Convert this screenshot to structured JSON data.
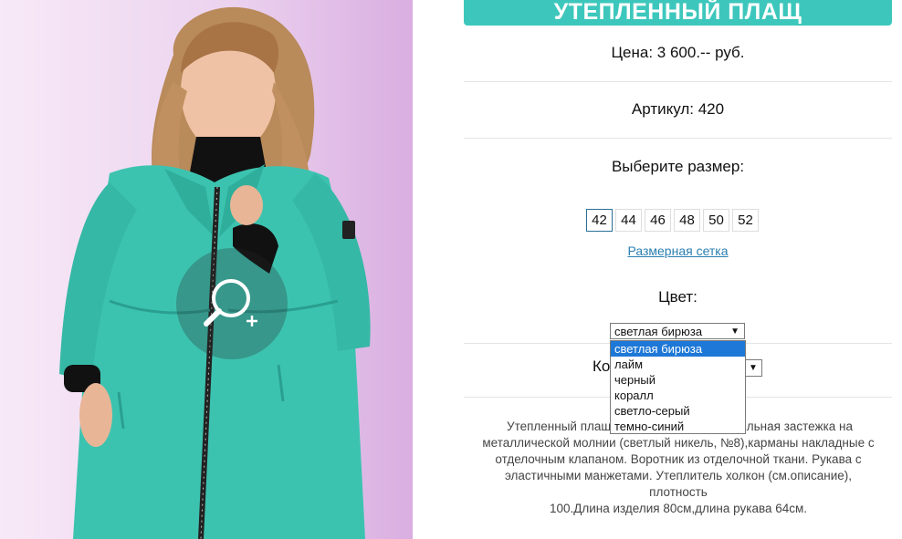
{
  "product": {
    "title": "УТЕПЛЕННЫЙ ПЛАЩ",
    "price": "Цена: 3 600.-- руб.",
    "article": "Артикул: 420",
    "choose_size": "Выберите размер:",
    "sizes": [
      "42",
      "44",
      "46",
      "48",
      "50",
      "52"
    ],
    "selected_size": "42",
    "size_chart_link": "Размерная сетка",
    "color_label": "Цвет:",
    "color_selected": "светлая бирюза",
    "color_options": [
      "светлая бирюза",
      "лайм",
      "черный",
      "коралл",
      "светло-серый",
      "темно-синий"
    ],
    "qty_label": "Ко",
    "description_lines": [
      "Утепленный плащ",
      "льная застежка на",
      "металлической молнии (светлый никель, №8),карманы накладные с",
      "отделочным клапаном. Воротник из отделочной ткани. Рукава с",
      "эластичными манжетами. Утеплитель холкон (см.описание), плотность",
      "100.Длина изделия 80см,длина рукава 64см."
    ]
  },
  "icons": {
    "zoom": "zoom-in-icon",
    "dropdown_caret": "caret-down-icon"
  },
  "colors": {
    "accent": "#3dc7bc",
    "coat": "#3cc3b0",
    "background_photo": "#e6c4ea",
    "selection": "#1e78d7",
    "link": "#2b7fb0"
  }
}
